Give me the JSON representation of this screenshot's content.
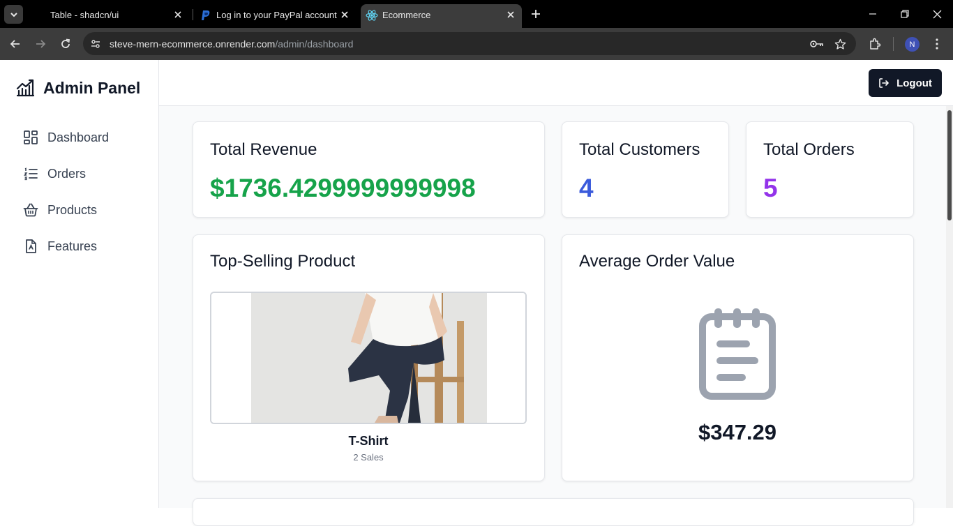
{
  "browser": {
    "tabs": [
      {
        "title": "Table - shadcn/ui",
        "active": false
      },
      {
        "title": "Log in to your PayPal account",
        "active": false
      },
      {
        "title": "Ecommerce",
        "active": true
      }
    ],
    "url_host": "steve-mern-ecommerce.onrender.com",
    "url_path": "/admin/dashboard",
    "profile_initial": "N"
  },
  "sidebar": {
    "brand": "Admin Panel",
    "items": [
      {
        "label": "Dashboard",
        "icon": "layout-dashboard-icon"
      },
      {
        "label": "Orders",
        "icon": "list-ordered-icon"
      },
      {
        "label": "Products",
        "icon": "shopping-basket-icon"
      },
      {
        "label": "Features",
        "icon": "badge-check-icon"
      }
    ]
  },
  "header": {
    "logout_label": "Logout"
  },
  "stats": {
    "revenue": {
      "title": "Total Revenue",
      "value": "$1736.4299999999998",
      "color": "#16a34a"
    },
    "customers": {
      "title": "Total Customers",
      "value": "4",
      "color": "#3b5bdb"
    },
    "orders": {
      "title": "Total Orders",
      "value": "5",
      "color": "#9333ea"
    }
  },
  "top_product": {
    "title": "Top-Selling Product",
    "name": "T-Shirt",
    "sales": "2 Sales"
  },
  "aov": {
    "title": "Average Order Value",
    "value": "$347.29"
  }
}
